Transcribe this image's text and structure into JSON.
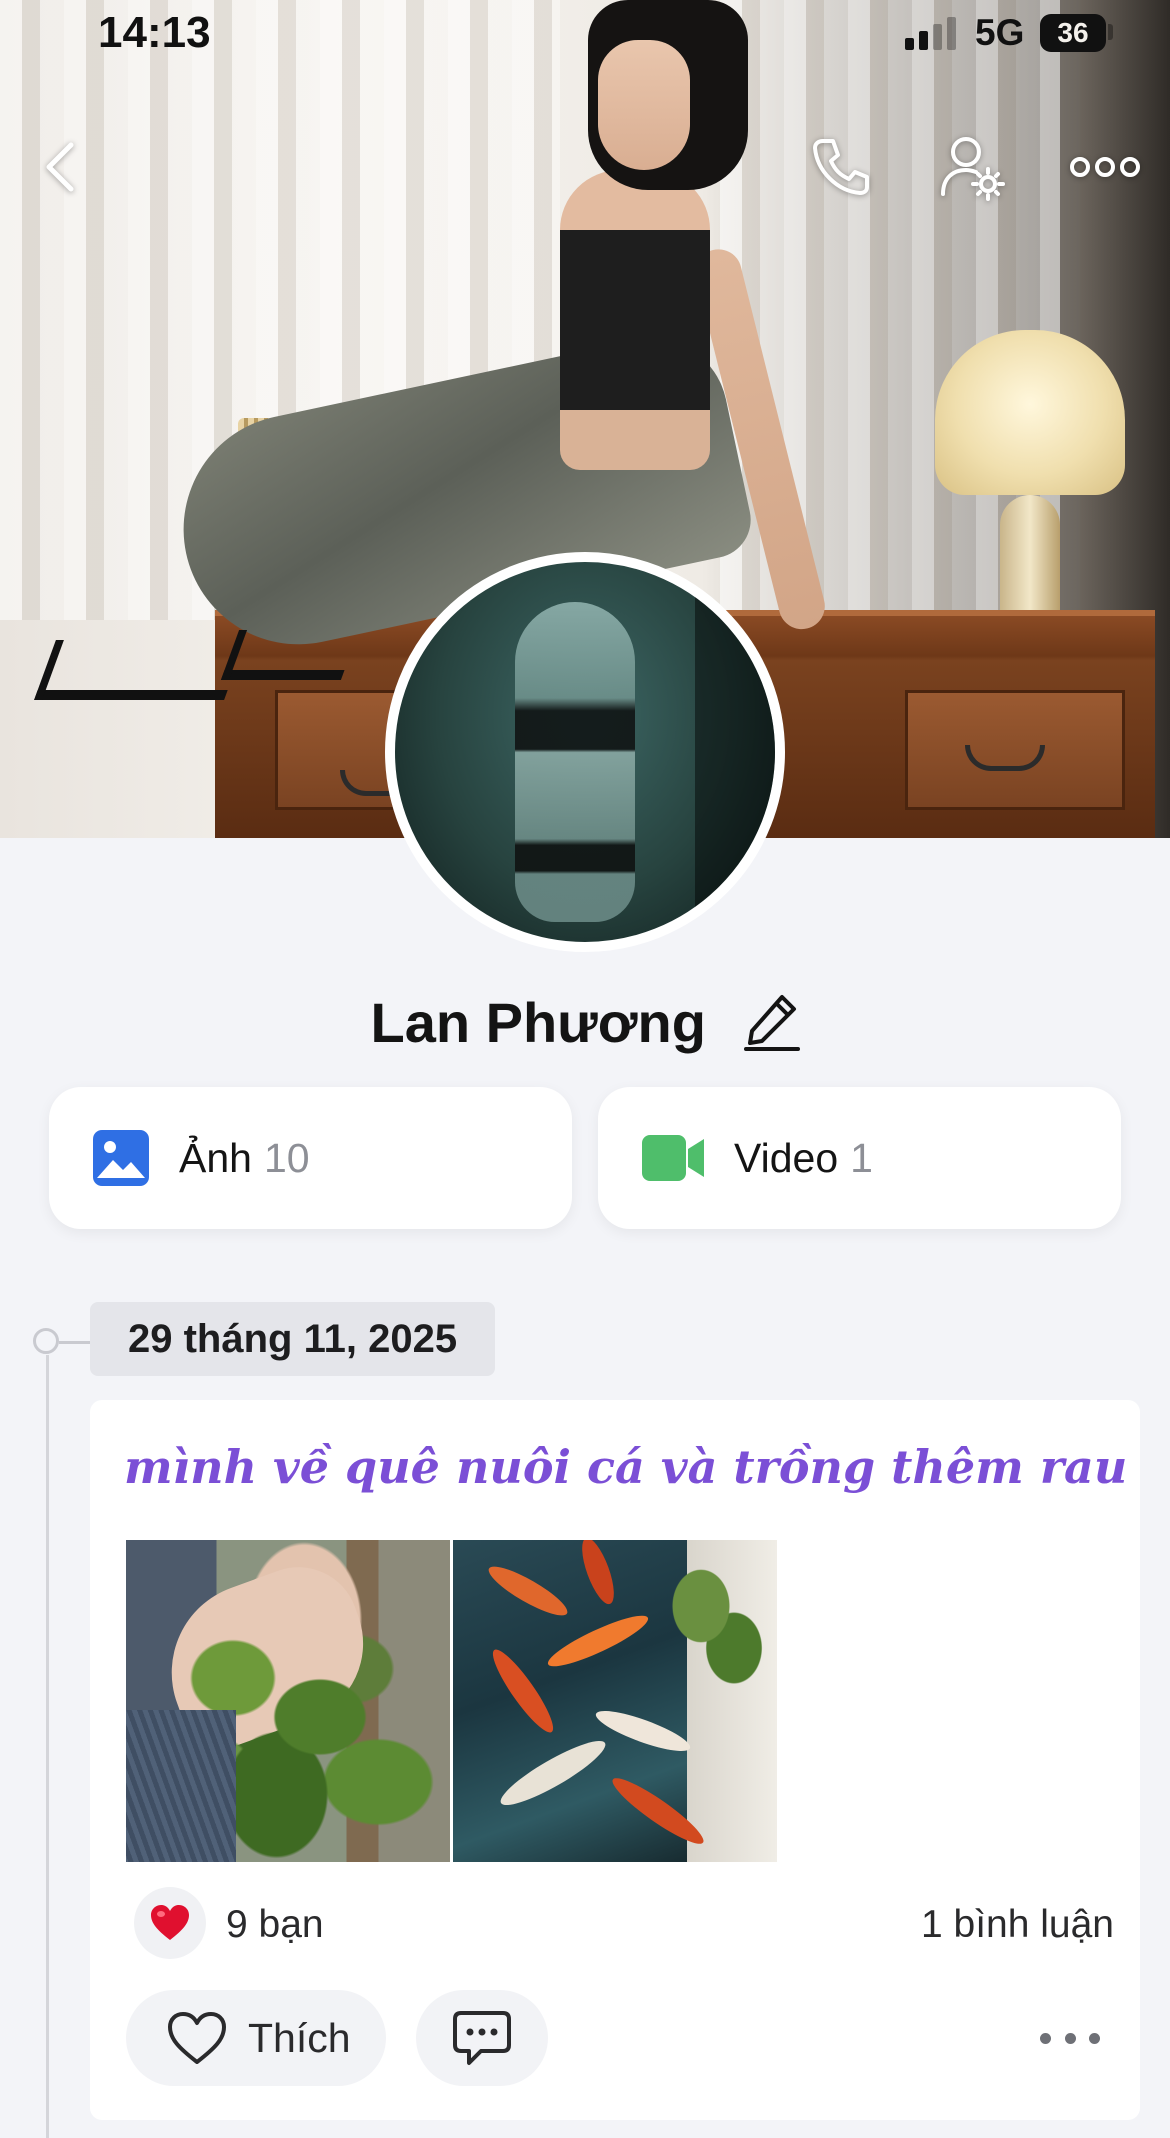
{
  "status_bar": {
    "time": "14:13",
    "network": "5G",
    "battery": "36"
  },
  "nav": {
    "back_icon": "chevron-left-icon",
    "call_icon": "phone-icon",
    "profile_settings_icon": "user-gear-icon",
    "more_icon": "ellipsis-icon"
  },
  "profile": {
    "name": "Lan Phương",
    "edit_icon": "pencil-icon"
  },
  "media": {
    "photos_label": "Ảnh",
    "photos_count": "10",
    "photos_icon": "image-icon",
    "photos_icon_color": "#2f6fe4",
    "videos_label": "Video",
    "videos_count": "1",
    "videos_icon": "video-camera-icon",
    "videos_icon_color": "#4fbe6b"
  },
  "timeline": {
    "date": "29 tháng 11, 2025"
  },
  "post": {
    "text": "mình về quê nuôi cá và trồng thêm rau",
    "text_color": "#7b4fd6",
    "reaction_icon": "heart-icon",
    "reaction_count": "9 bạn",
    "comment_count": "1 bình luận",
    "like_label": "Thích",
    "like_icon": "heart-outline-icon",
    "comment_icon": "chat-bubble-icon",
    "more_icon": "ellipsis-icon"
  }
}
